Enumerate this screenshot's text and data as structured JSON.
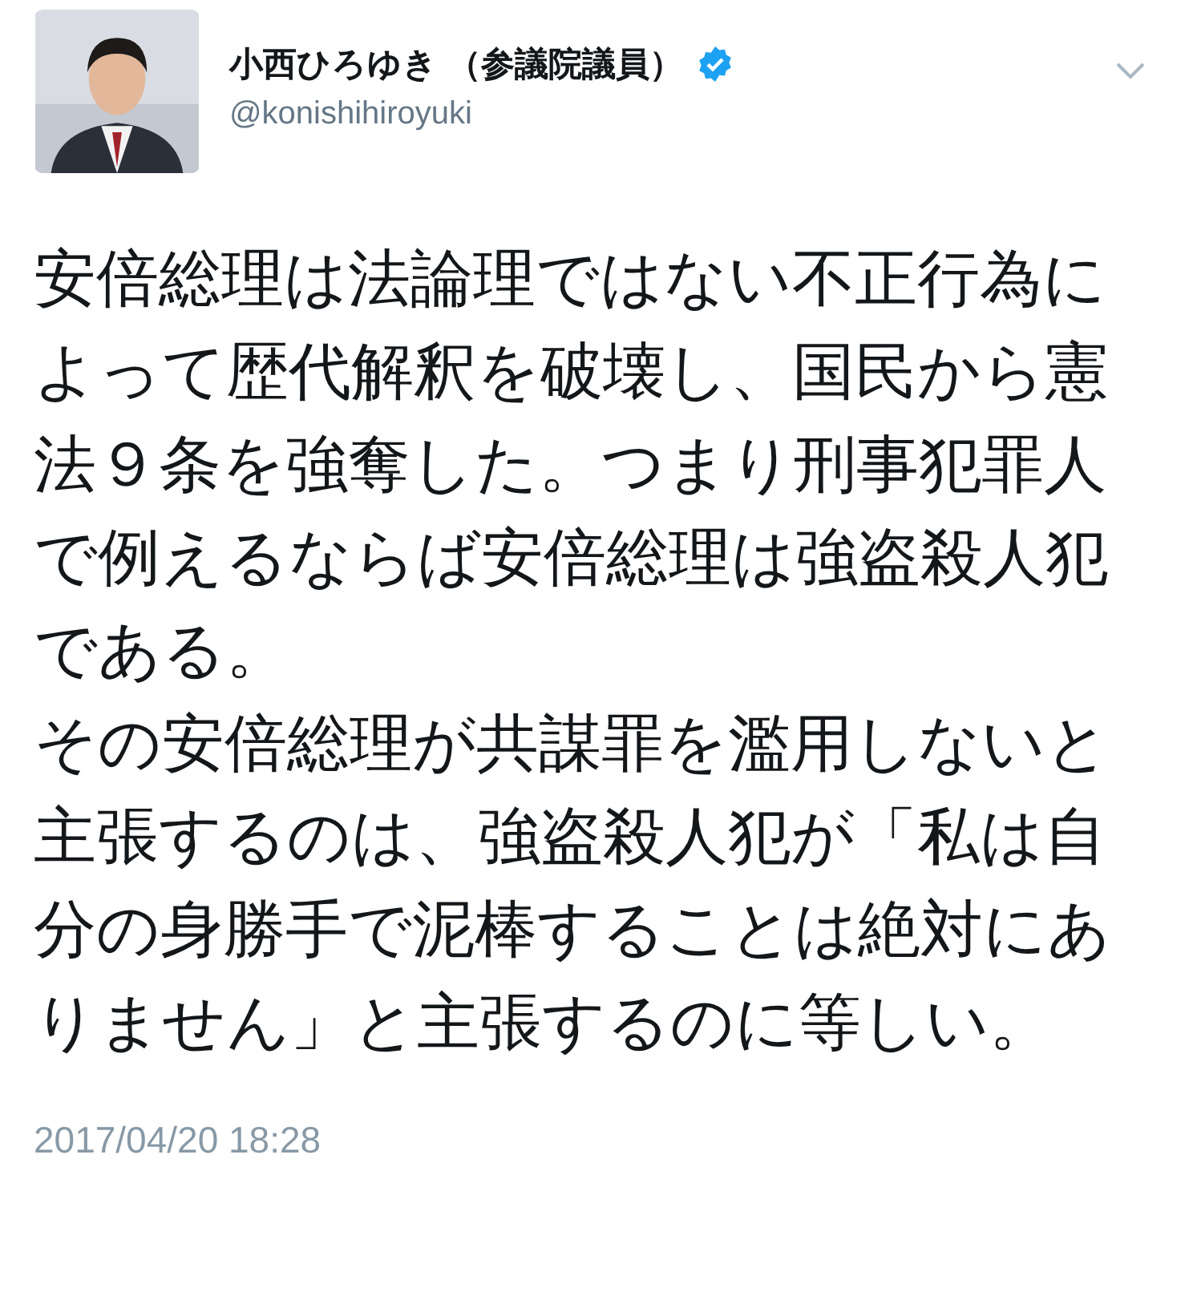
{
  "author": {
    "name": "小西ひろゆき （参議院議員）",
    "handle": "@konishihiroyuki",
    "verified": true
  },
  "paragraphs": [
    "安倍総理は法論理ではない不正行為によって歴代解釈を破壊し、国民から憲法９条を強奪した。つまり刑事犯罪人で例えるならば安倍総理は強盗殺人犯である。",
    "その安倍総理が共謀罪を濫用しないと主張するのは、強盗殺人犯が「私は自分の身勝手で泥棒することは絶対にありません」と主張するのに等しい。"
  ],
  "timestamp": "2017/04/20 18:28"
}
